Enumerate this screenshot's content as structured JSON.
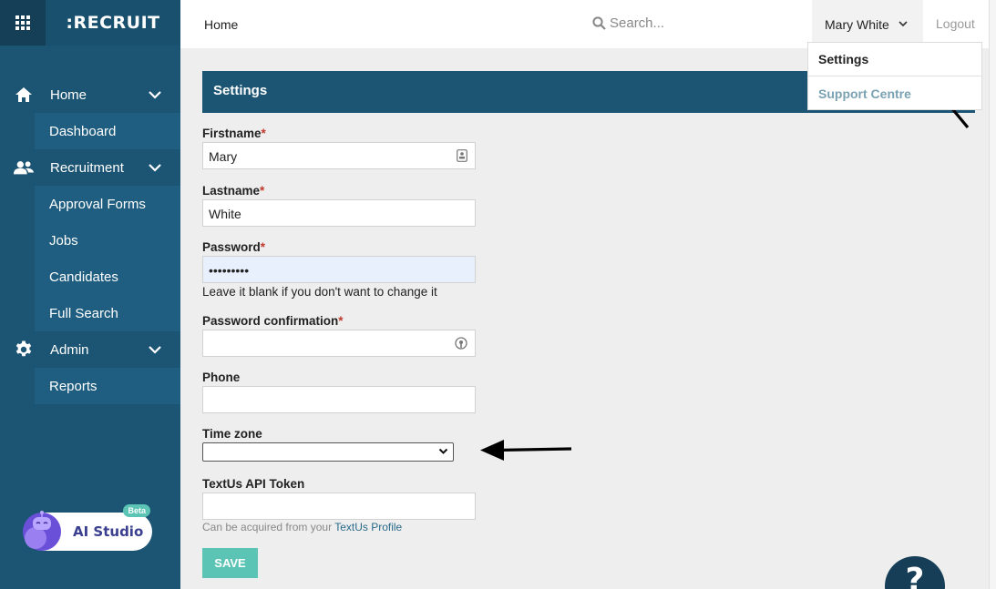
{
  "brand": {
    "name": ":RECRUIT"
  },
  "sidebar": {
    "groups": [
      {
        "label": "Home",
        "icon": "home-icon",
        "items": [
          {
            "label": "Dashboard"
          }
        ]
      },
      {
        "label": "Recruitment",
        "icon": "people-icon",
        "items": [
          {
            "label": "Approval Forms"
          },
          {
            "label": "Jobs"
          },
          {
            "label": "Candidates"
          },
          {
            "label": "Full Search"
          }
        ]
      },
      {
        "label": "Admin",
        "icon": "gear-icon",
        "items": [
          {
            "label": "Reports"
          }
        ]
      }
    ],
    "ai_studio": {
      "label": "AI Studio",
      "badge": "Beta"
    }
  },
  "topbar": {
    "breadcrumb": "Home",
    "search_placeholder": "Search...",
    "user_name": "Mary White",
    "logout_label": "Logout"
  },
  "user_dropdown": {
    "items": [
      {
        "label": "Settings"
      },
      {
        "label": "Support Centre"
      }
    ]
  },
  "main": {
    "title": "Settings",
    "fields": {
      "firstname": {
        "label": "Firstname",
        "value": "Mary",
        "required": "*"
      },
      "lastname": {
        "label": "Lastname",
        "value": "White",
        "required": "*"
      },
      "password": {
        "label": "Password",
        "value": "•••••••••",
        "required": "*",
        "hint": "Leave it blank if you don't want to change it"
      },
      "password_confirmation": {
        "label": "Password confirmation",
        "value": "",
        "required": "*"
      },
      "phone": {
        "label": "Phone",
        "value": ""
      },
      "time_zone": {
        "label": "Time zone",
        "value": ""
      },
      "textus_token": {
        "label": "TextUs API Token",
        "value": "",
        "hint_prefix": "Can be acquired from your ",
        "hint_link": "TextUs Profile"
      }
    },
    "save_label": "SAVE"
  },
  "help": {
    "label": "?"
  },
  "colors": {
    "sidebar": "#1c5574",
    "accent": "#5bc4b5",
    "header": "#1c5574"
  }
}
